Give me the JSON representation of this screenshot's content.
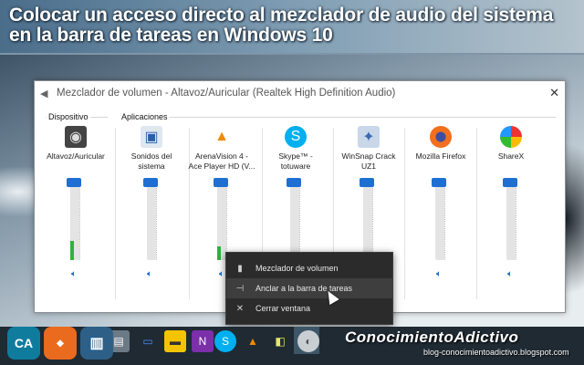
{
  "banner": {
    "title_line1": "Colocar un acceso directo al mezclador de audio del sistema",
    "title_line2": "en la barra de tareas en Windows 10"
  },
  "mixer": {
    "title": "Mezclador de volumen - Altavoz/Auricular (Realtek High Definition Audio)",
    "close_glyph": "✕",
    "group_device": "Dispositivo",
    "group_apps": "Aplicaciones",
    "channels": [
      {
        "name": "Altavoz/Auricular",
        "icon": "speaker-icon",
        "level": 0.25
      },
      {
        "name": "Sonidos del\nsistema",
        "icon": "system-sounds-icon",
        "level": 0
      },
      {
        "name": "ArenaVision 4 -\nAce Player HD (V...",
        "icon": "vlc-icon",
        "level": 0.18
      },
      {
        "name": "Skype™ -\ntotuware",
        "icon": "skype-icon",
        "level": 0
      },
      {
        "name": "WinSnap Crack\nUZ1",
        "icon": "winsnap-icon",
        "level": 0
      },
      {
        "name": "Mozilla Firefox",
        "icon": "firefox-icon",
        "level": 0
      },
      {
        "name": "ShareX",
        "icon": "sharex-icon",
        "level": 0
      }
    ]
  },
  "context_menu": {
    "items": [
      {
        "label": "Mezclador de volumen",
        "icon": "volume-icon"
      },
      {
        "label": "Anclar a la barra de tareas",
        "icon": "pin-icon"
      },
      {
        "label": "Cerrar ventana",
        "icon": "close-icon"
      }
    ]
  },
  "watermark": {
    "brand": "ConocimientoAdictivo",
    "blog": "blog-conocimientoadictivo.blogspot.com",
    "logo1": "CA"
  },
  "colors": {
    "accent": "#1e6fd1",
    "level_green": "#2fb33a",
    "menu_bg": "#2b2b2b",
    "taskbar": "#1f2a33"
  }
}
